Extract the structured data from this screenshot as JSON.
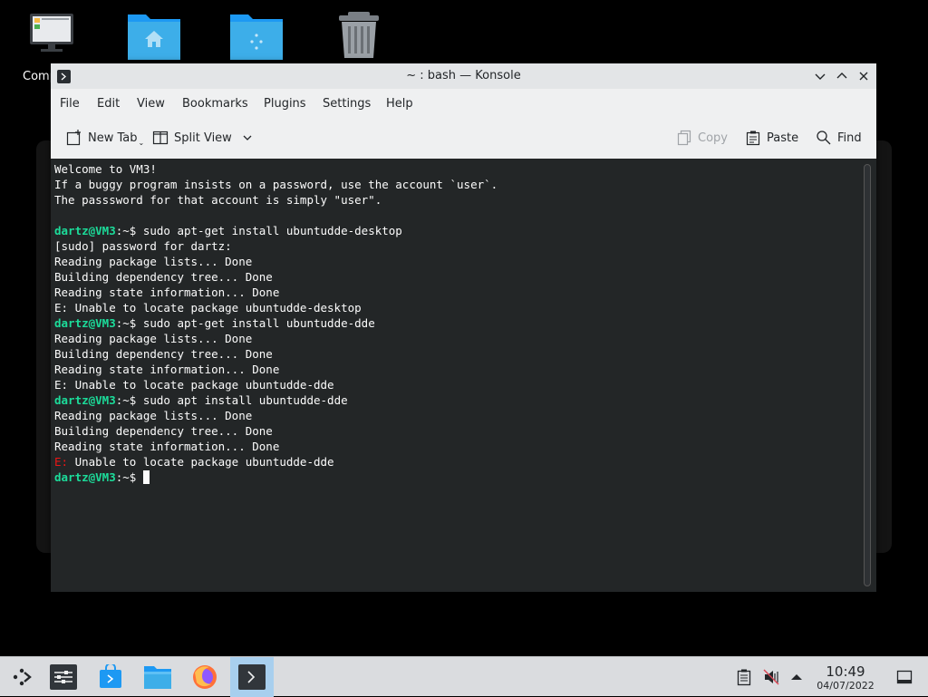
{
  "desktop": {
    "icons": [
      {
        "label": "Comp",
        "icon": "computer-icon"
      },
      {
        "label": "",
        "icon": "home-folder-icon"
      },
      {
        "label": "",
        "icon": "network-folder-icon"
      },
      {
        "label": "",
        "icon": "trash-icon"
      }
    ]
  },
  "window": {
    "title": "~ : bash — Konsole",
    "menu": [
      "File",
      "Edit",
      "View",
      "Bookmarks",
      "Plugins",
      "Settings",
      "Help"
    ],
    "toolbar": {
      "new_tab": "New Tab",
      "split_view": "Split View",
      "copy": "Copy",
      "paste": "Paste",
      "find": "Find"
    }
  },
  "terminal": {
    "prompt_user": "dartz@VM3",
    "prompt_path": ":~",
    "prompt_symbol": "$",
    "lines": [
      {
        "text": "Welcome to VM3!"
      },
      {
        "text": "If a buggy program insists on a password, use the account `user`."
      },
      {
        "text": "The passsword for that account is simply \"user\"."
      },
      {
        "text": ""
      },
      {
        "cmd": " sudo apt-get install ubuntudde-desktop"
      },
      {
        "text": "[sudo] password for dartz:"
      },
      {
        "text": "Reading package lists... Done"
      },
      {
        "text": "Building dependency tree... Done"
      },
      {
        "text": "Reading state information... Done"
      },
      {
        "text": "E: Unable to locate package ubuntudde-desktop"
      },
      {
        "cmd": " sudo apt-get install ubuntudde-dde"
      },
      {
        "text": "Reading package lists... Done"
      },
      {
        "text": "Building dependency tree... Done"
      },
      {
        "text": "Reading state information... Done"
      },
      {
        "text": "E: Unable to locate package ubuntudde-dde"
      },
      {
        "cmd": " sudo apt install ubuntudde-dde"
      },
      {
        "text": "Reading package lists... Done"
      },
      {
        "text": "Building dependency tree... Done"
      },
      {
        "text": "Reading state information... Done"
      },
      {
        "err_prefix": "E:",
        "text": " Unable to locate package ubuntudde-dde"
      },
      {
        "cmd": " ",
        "cursor": true
      }
    ]
  },
  "taskbar": {
    "time": "10:49",
    "date": "04/07/2022",
    "apps": [
      "application-launcher-icon",
      "system-settings-icon",
      "discover-store-icon",
      "dolphin-files-icon",
      "firefox-icon",
      "konsole-icon"
    ]
  },
  "colors": {
    "terminal_bg": "#232627",
    "prompt_user": "#1cdc9a",
    "error": "#ed1515",
    "active_task": "#a8cfee"
  }
}
